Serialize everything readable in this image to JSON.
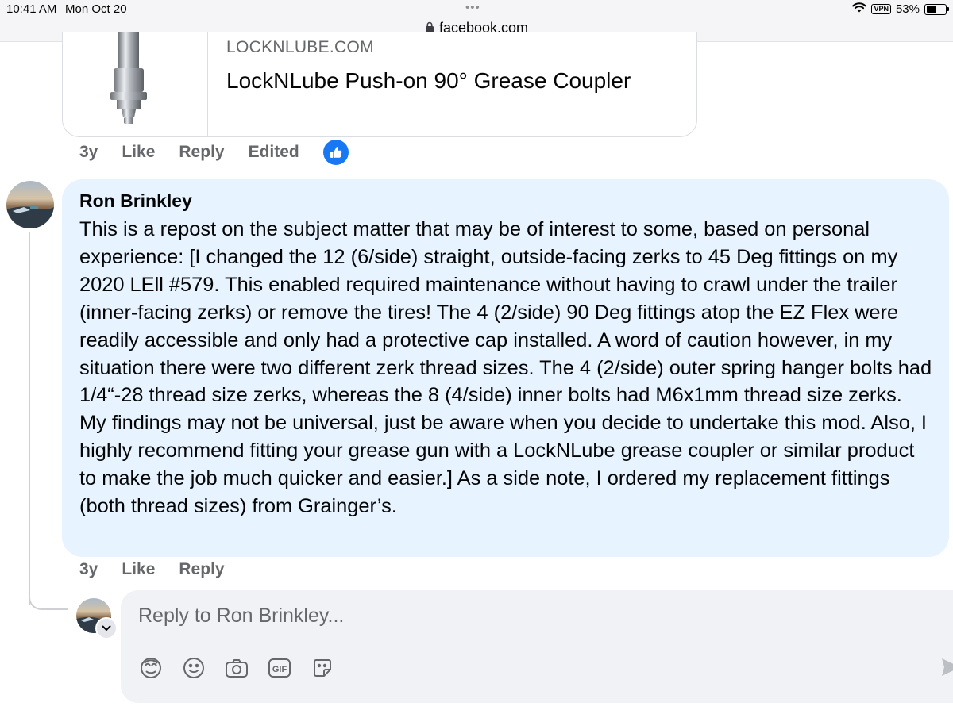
{
  "status_bar": {
    "time": "10:41 AM",
    "date": "Mon Oct 20",
    "dots": "•••",
    "url": "facebook.com",
    "vpn": "VPN",
    "battery": "53%",
    "battery_level": 0.53
  },
  "link_preview": {
    "domain": "LOCKNLUBE.COM",
    "title": "LockNLube Push-on 90° Grease Coupler",
    "thumb_icon": "grease-fitting-icon"
  },
  "prev_actions": {
    "age": "3y",
    "like": "Like",
    "reply": "Reply",
    "edited": "Edited",
    "reaction_icon": "thumbs-up-icon"
  },
  "comment": {
    "author": "Ron Brinkley",
    "text": "This is a repost on the subject matter that may be of interest to some, based on personal experience: [I changed the 12 (6/side) straight, outside-facing zerks to 45 Deg fittings on my 2020 LEll #579. This enabled required maintenance without having to crawl under the trailer (inner-facing zerks) or remove the tires! The 4 (2/side) 90 Deg fittings atop the EZ Flex were readily accessible and only had a protective cap installed. A word of caution however, in my situation there were two different zerk thread sizes. The 4 (2/side) outer spring hanger bolts had 1/4“-28 thread size zerks, whereas the 8 (4/side) inner bolts had M6x1mm thread size zerks. My findings may not be universal, just be aware when you decide to undertake this mod. Also, I highly recommend fitting your grease gun with a LockNLube grease coupler or similar product to make the job much quicker and easier.] As a side note, I ordered my replacement fittings (both thread sizes) from Grainger’s.",
    "age": "3y",
    "like": "Like",
    "reply": "Reply"
  },
  "composer": {
    "placeholder": "Reply to Ron Brinkley...",
    "tools": [
      "avatar-sticker-icon",
      "emoji-icon",
      "camera-icon",
      "gif-icon",
      "sticker-icon"
    ],
    "gif_label": "GIF"
  },
  "colors": {
    "accent": "#1877f2",
    "bubble": "#e7f3ff",
    "muted_text": "#65676b",
    "composer_bg": "#f0f2f5"
  }
}
